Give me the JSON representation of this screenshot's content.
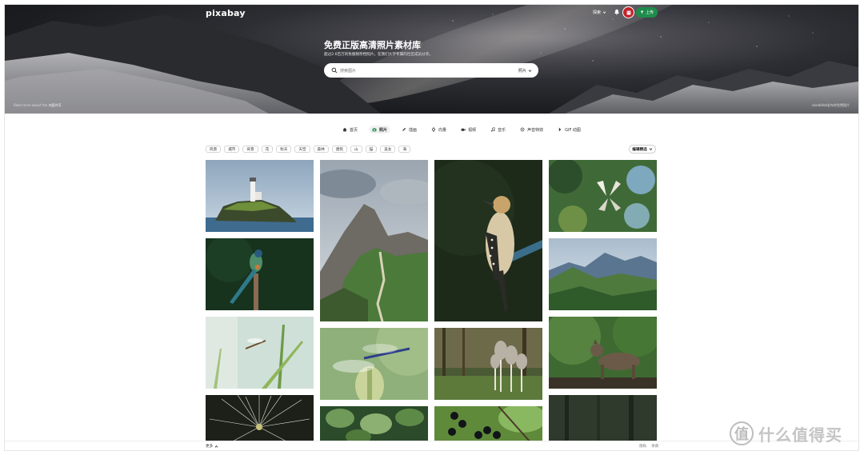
{
  "header": {
    "logo": "pixabay",
    "explore_label": "探索",
    "upload_label": "上传"
  },
  "hero": {
    "title": "免费正版高清照片素材库",
    "subtitle": "超过2.6百万的免版税存档照片，在我们大学专属的社区成员分享。",
    "search_placeholder": "搜索图片",
    "search_type": "照片",
    "credit_left_prefix": "Read more about the ",
    "credit_left_link": "内容许可",
    "credit_right": "ckeeb9eb发布的免费图片"
  },
  "tabs": [
    {
      "label": "首页",
      "icon": "home-icon"
    },
    {
      "label": "照片",
      "icon": "camera-icon",
      "active": true
    },
    {
      "label": "插画",
      "icon": "pencil-icon"
    },
    {
      "label": "向量",
      "icon": "vector-icon"
    },
    {
      "label": "视频",
      "icon": "video-icon"
    },
    {
      "label": "音乐",
      "icon": "music-icon"
    },
    {
      "label": "声音特效",
      "icon": "sound-icon"
    },
    {
      "label": "GIF 动图",
      "icon": "gif-icon"
    }
  ],
  "chips": [
    "风景",
    "城市",
    "背景",
    "花",
    "秋天",
    "天空",
    "森林",
    "建筑",
    "山",
    "猫",
    "美女",
    "海"
  ],
  "editor_choice": "编辑精选",
  "images": [
    {
      "name": "lighthouse-island-image",
      "subject": "lighthouse"
    },
    {
      "name": "motmot-bird-image",
      "subject": "bird"
    },
    {
      "name": "dragonfly-grass-image",
      "subject": "dragonfly"
    },
    {
      "name": "dandelion-image",
      "subject": "dandelion"
    },
    {
      "name": "mountain-peak-image",
      "subject": "mountain"
    },
    {
      "name": "dragonfly-bud-image",
      "subject": "dragonfly"
    },
    {
      "name": "ivy-leaves-image",
      "subject": "leaves"
    },
    {
      "name": "woodpecker-image",
      "subject": "bird"
    },
    {
      "name": "mushrooms-image",
      "subject": "mushrooms"
    },
    {
      "name": "berries-image",
      "subject": "berries"
    },
    {
      "name": "butterfly-bokeh-image",
      "subject": "butterfly"
    },
    {
      "name": "alpine-valley-image",
      "subject": "landscape"
    },
    {
      "name": "wild-cat-image",
      "subject": "cat"
    },
    {
      "name": "dark-forest-image",
      "subject": "forest"
    }
  ],
  "footer": {
    "more_label": "更多",
    "links": [
      "隐私",
      "条款"
    ]
  },
  "watermark": {
    "symbol": "值",
    "text": "什么值得买"
  }
}
